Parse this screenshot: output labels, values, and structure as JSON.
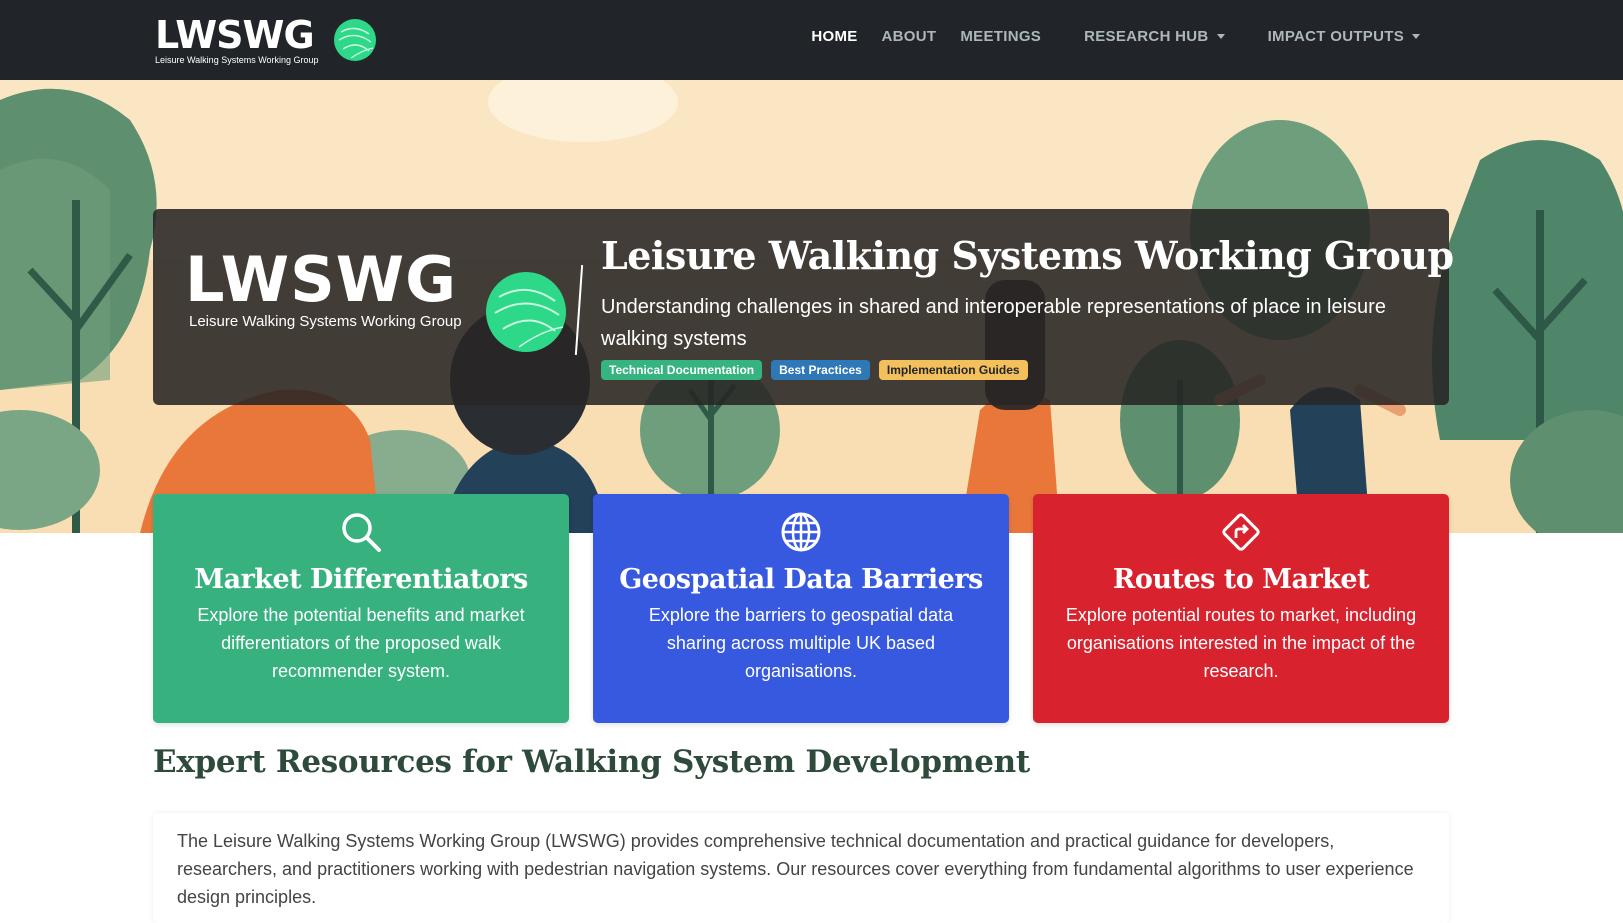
{
  "brand": {
    "title": "LWSWG",
    "subtitle": "Leisure Walking Systems Working Group",
    "orb_color": "#2ed889"
  },
  "nav": {
    "items": [
      {
        "label": "HOME",
        "active": true
      },
      {
        "label": "ABOUT"
      },
      {
        "label": "MEETINGS"
      },
      {
        "label": "RESEARCH HUB",
        "dropdown": true
      },
      {
        "label": "IMPACT OUTPUTS",
        "dropdown": true
      }
    ]
  },
  "hero": {
    "logo_title": "LWSWG",
    "logo_subtitle": "Leisure Walking Systems Working Group",
    "title": "Leisure Walking Systems Working Group",
    "description": "Understanding challenges in shared and interoperable representations of place in leisure walking systems",
    "badges": [
      {
        "label": "Technical Documentation",
        "color": "#35b47f"
      },
      {
        "label": "Best Practices",
        "color": "#2f78b8"
      },
      {
        "label": "Implementation Guides",
        "color": "#f3c05c"
      }
    ]
  },
  "features": [
    {
      "icon": "search-icon",
      "title": "Market Differentiators",
      "description": "Explore the potential benefits and market differentiators of the proposed walk recommender system.",
      "color": "#37b27f"
    },
    {
      "icon": "globe-icon",
      "title": "Geospatial Data Barriers",
      "description": "Explore the barriers to geospatial data sharing across multiple UK based organisations.",
      "color": "#3759e0"
    },
    {
      "icon": "route-sign-icon",
      "title": "Routes to Market",
      "description": "Explore potential routes to market, including organisations interested in the impact of the research.",
      "color": "#d8232f"
    }
  ],
  "section": {
    "title": "Expert Resources for Walking System Development",
    "intro": "The Leisure Walking Systems Working Group (LWSWG) provides comprehensive technical documentation and practical guidance for developers, researchers, and practitioners working with pedestrian navigation systems. Our resources cover everything from fundamental algorithms to user experience design principles."
  }
}
